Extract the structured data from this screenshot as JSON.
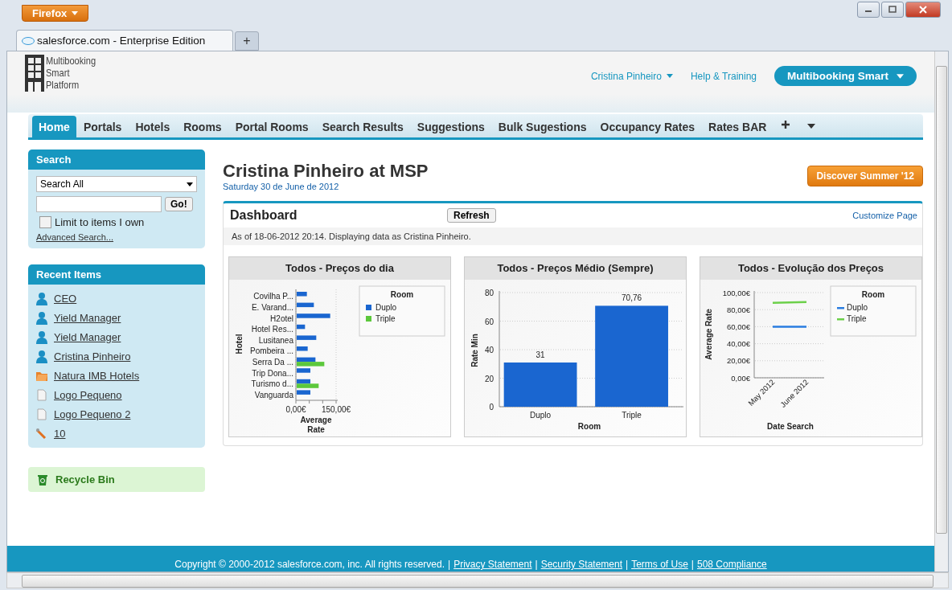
{
  "browser": {
    "menu_button": "Firefox",
    "tab_title": "salesforce.com - Enterprise Edition",
    "new_tab": "+"
  },
  "header": {
    "logo_lines": [
      "Multibooking",
      "Smart",
      "Platform"
    ],
    "user_menu": "Cristina Pinheiro",
    "help_link": "Help & Training",
    "app_menu": "Multibooking Smart"
  },
  "nav": {
    "tabs": [
      {
        "label": "Home",
        "selected": true
      },
      {
        "label": "Portals",
        "selected": false
      },
      {
        "label": "Hotels",
        "selected": false
      },
      {
        "label": "Rooms",
        "selected": false
      },
      {
        "label": "Portal Rooms",
        "selected": false
      },
      {
        "label": "Search Results",
        "selected": false
      },
      {
        "label": "Suggestions",
        "selected": false
      },
      {
        "label": "Bulk Sugestions",
        "selected": false
      },
      {
        "label": "Occupancy Rates",
        "selected": false
      },
      {
        "label": "Rates BAR",
        "selected": false
      }
    ]
  },
  "sidebar": {
    "search": {
      "title": "Search",
      "scope": "Search All",
      "button": "Go!",
      "limit_label": "Limit to items I own",
      "limit_checked": false,
      "advanced_link": "Advanced Search..."
    },
    "recent": {
      "title": "Recent Items",
      "items": [
        {
          "label": "CEO",
          "kind": "user"
        },
        {
          "label": "Yield Manager",
          "kind": "user"
        },
        {
          "label": "Yield Manager",
          "kind": "user"
        },
        {
          "label": "Cristina Pinheiro",
          "kind": "user"
        },
        {
          "label": "Natura IMB Hotels",
          "kind": "account"
        },
        {
          "label": "Logo Pequeno",
          "kind": "document"
        },
        {
          "label": "Logo Pequeno 2",
          "kind": "document"
        },
        {
          "label": "10",
          "kind": "tool"
        }
      ]
    },
    "recycle_bin": "Recycle Bin"
  },
  "main": {
    "title": "Cristina Pinheiro at MSP",
    "date": "Saturday 30 de June de 2012",
    "promo_button": "Discover Summer '12",
    "dashboard": {
      "title": "Dashboard",
      "refresh": "Refresh",
      "customize": "Customize Page",
      "status": "As of 18-06-2012 20:14. Displaying data as Cristina Pinheiro.",
      "charts": [
        {
          "chart_data": {
            "type": "bar",
            "orientation": "horizontal",
            "title": "Todos - Preços do dia",
            "xlabel": "Average Rate",
            "ylabel": "Hotel",
            "legend": {
              "title": "Room"
            },
            "grid": true,
            "categories": [
              "Covilha P...",
              "E. Varand...",
              "H2otel",
              "Hotel Res...",
              "Lusitanea",
              "Pombeira ...",
              "Serra Da ...",
              "Trip Dona...",
              "Turismo d...",
              "Vanguarda"
            ],
            "series": [
              {
                "name": "Duplo",
                "color": "#1a66d0",
                "values": [
                  41,
                  67,
                  128,
                  34,
                  76,
                  44,
                  73,
                  54,
                  54,
                  54
                ]
              },
              {
                "name": "Triple",
                "color": "#5cc83c",
                "values": [
                  null,
                  null,
                  null,
                  null,
                  null,
                  null,
                  106,
                  null,
                  85,
                  null
                ]
              }
            ],
            "xlim": [
              0,
              150
            ],
            "xticks": [
              {
                "value": 0,
                "label": "0,00€"
              },
              {
                "value": 150,
                "label": "150,00€"
              }
            ]
          }
        },
        {
          "chart_data": {
            "type": "bar",
            "orientation": "vertical",
            "title": "Todos - Preços Médio (Sempre)",
            "xlabel": "Room",
            "ylabel": "Rate Min",
            "grid": true,
            "categories": [
              "Duplo",
              "Triple"
            ],
            "values": [
              31,
              70.76
            ],
            "ylim": [
              0,
              80
            ],
            "yticks": [
              0,
              20,
              40,
              60,
              80
            ],
            "value_labels": [
              "31",
              "70,76"
            ]
          }
        },
        {
          "chart_data": {
            "type": "line",
            "title": "Todos - Evolução dos Preços",
            "xlabel": "Date Search",
            "ylabel": "Average Rate",
            "legend": {
              "title": "Room"
            },
            "grid": true,
            "categories": [
              "May 2012",
              "June 2012"
            ],
            "series": [
              {
                "name": "Duplo",
                "color": "#2a7de0",
                "values": [
                  60,
                  60
                ]
              },
              {
                "name": "Triple",
                "color": "#6cd04a",
                "values": [
                  88,
                  89
                ]
              }
            ],
            "ylim": [
              0,
              100
            ],
            "yticks": [
              {
                "value": 0,
                "label": "0,00€"
              },
              {
                "value": 20,
                "label": "20,00€"
              },
              {
                "value": 40,
                "label": "40,00€"
              },
              {
                "value": 60,
                "label": "60,00€"
              },
              {
                "value": 80,
                "label": "80,00€"
              },
              {
                "value": 100,
                "label": "100,00€"
              }
            ]
          }
        }
      ]
    }
  },
  "footer": [
    {
      "kind": "text",
      "text": "Copyright © 2000-2012 salesforce.com, inc. All rights reserved."
    },
    {
      "kind": "sep",
      "text": "|"
    },
    {
      "kind": "link",
      "text": "Privacy Statement"
    },
    {
      "kind": "sep",
      "text": "|"
    },
    {
      "kind": "link",
      "text": "Security Statement"
    },
    {
      "kind": "sep",
      "text": "|"
    },
    {
      "kind": "link",
      "text": "Terms of Use"
    },
    {
      "kind": "sep",
      "text": "|"
    },
    {
      "kind": "link",
      "text": "508 Compliance"
    }
  ]
}
